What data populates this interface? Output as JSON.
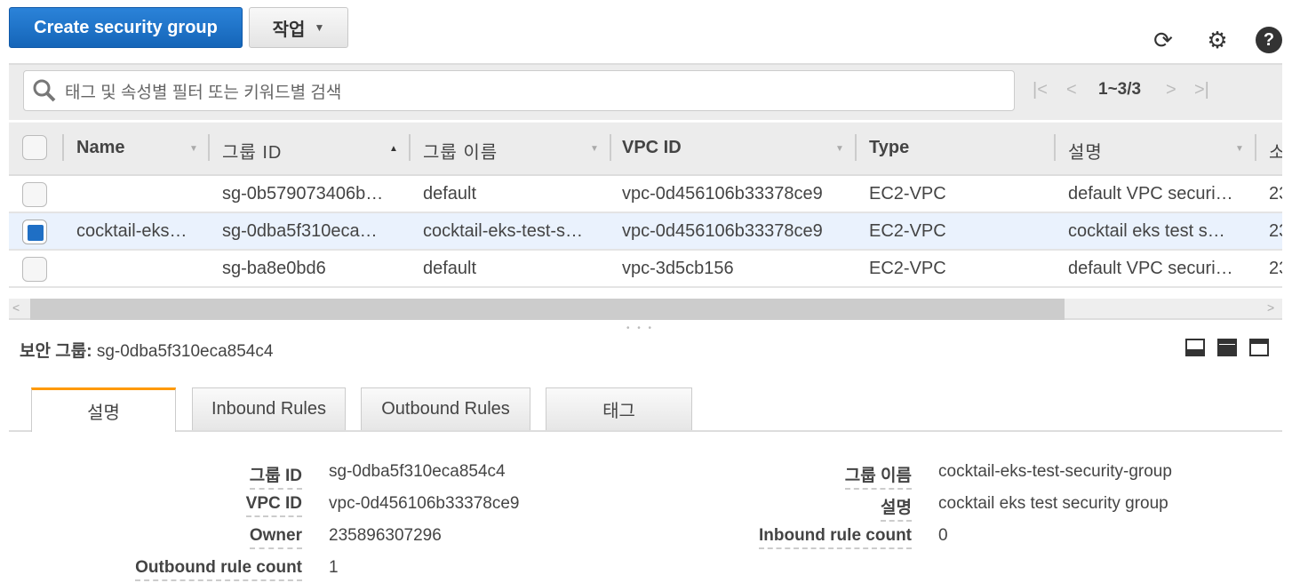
{
  "toolbar": {
    "create_label": "Create security group",
    "actions_label": "작업"
  },
  "search": {
    "placeholder": "태그 및 속성별 필터 또는 키워드별 검색"
  },
  "pager": {
    "range": "1~3/3"
  },
  "columns": [
    "Name",
    "그룹 ID",
    "그룹 이름",
    "VPC ID",
    "Type",
    "설명",
    "소"
  ],
  "rows": [
    {
      "selected": false,
      "name": "",
      "group_id": "sg-0b579073406b…",
      "group_name": "default",
      "vpc_id": "vpc-0d456106b33378ce9",
      "type": "EC2-VPC",
      "desc": "default VPC securi…",
      "owner": "23"
    },
    {
      "selected": true,
      "name": "cocktail-eks…",
      "group_id": "sg-0dba5f310eca…",
      "group_name": "cocktail-eks-test-s…",
      "vpc_id": "vpc-0d456106b33378ce9",
      "type": "EC2-VPC",
      "desc": "cocktail eks test s…",
      "owner": "23"
    },
    {
      "selected": false,
      "name": "",
      "group_id": "sg-ba8e0bd6",
      "group_name": "default",
      "vpc_id": "vpc-3d5cb156",
      "type": "EC2-VPC",
      "desc": "default VPC securi…",
      "owner": "23"
    }
  ],
  "detail": {
    "title_label": "보안 그룹:",
    "title_value": "sg-0dba5f310eca854c4",
    "tabs": [
      "설명",
      "Inbound Rules",
      "Outbound Rules",
      "태그"
    ],
    "left": [
      {
        "label": "그룹 ID",
        "value": "sg-0dba5f310eca854c4"
      },
      {
        "label": "VPC ID",
        "value": "vpc-0d456106b33378ce9"
      },
      {
        "label": "Owner",
        "value": "235896307296"
      },
      {
        "label": "Outbound rule count",
        "value": "1"
      }
    ],
    "right": [
      {
        "label": "그룹 이름",
        "value": "cocktail-eks-test-security-group"
      },
      {
        "label": "설명",
        "value": "cocktail eks test security group"
      },
      {
        "label": "Inbound rule count",
        "value": "0"
      }
    ]
  }
}
